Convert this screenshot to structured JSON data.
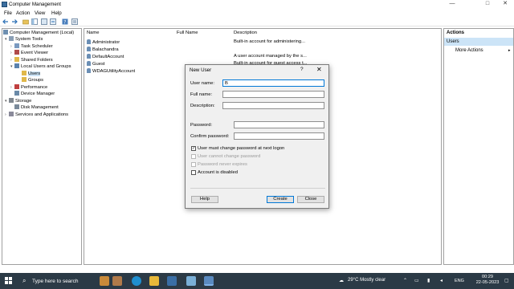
{
  "window": {
    "title": "Computer Management"
  },
  "menu": [
    "File",
    "Action",
    "View",
    "Help"
  ],
  "tree": {
    "items": [
      {
        "label": "Computer Management (Local)",
        "level": 0,
        "expander": ""
      },
      {
        "label": "System Tools",
        "level": 1,
        "expander": "▾"
      },
      {
        "label": "Task Scheduler",
        "level": 2,
        "expander": "›"
      },
      {
        "label": "Event Viewer",
        "level": 2,
        "expander": "›"
      },
      {
        "label": "Shared Folders",
        "level": 2,
        "expander": "›"
      },
      {
        "label": "Local Users and Groups",
        "level": 2,
        "expander": "▾"
      },
      {
        "label": "Users",
        "level": 3,
        "expander": ""
      },
      {
        "label": "Groups",
        "level": 3,
        "expander": ""
      },
      {
        "label": "Performance",
        "level": 2,
        "expander": "›"
      },
      {
        "label": "Device Manager",
        "level": 2,
        "expander": ""
      },
      {
        "label": "Storage",
        "level": 1,
        "expander": "▾"
      },
      {
        "label": "Disk Management",
        "level": 2,
        "expander": ""
      },
      {
        "label": "Services and Applications",
        "level": 1,
        "expander": "›"
      }
    ]
  },
  "list": {
    "columns": [
      "Name",
      "Full Name",
      "Description"
    ],
    "rows": [
      {
        "name": "Administrator",
        "full_name": "",
        "description": "Built-in account for administering..."
      },
      {
        "name": "Balachandra",
        "full_name": "",
        "description": ""
      },
      {
        "name": "DefaultAccount",
        "full_name": "",
        "description": "A user account managed by the s..."
      },
      {
        "name": "Guest",
        "full_name": "",
        "description": "Built-in account for guest access t..."
      },
      {
        "name": "WDAGUtilityAccount",
        "full_name": "",
        "description": ""
      }
    ]
  },
  "actions": {
    "header": "Actions",
    "section": "Users",
    "more": "More Actions"
  },
  "dialog": {
    "title": "New User",
    "help": "?",
    "close": "✕",
    "user_name_label": "User name:",
    "user_name_value": "B",
    "full_name_label": "Full name:",
    "full_name_value": "",
    "description_label": "Description:",
    "description_value": "",
    "password_label": "Password:",
    "confirm_label": "Confirm password:",
    "checkboxes": [
      {
        "label": "User must change password at next logon",
        "checked": true,
        "enabled": true
      },
      {
        "label": "User cannot change password",
        "checked": false,
        "enabled": false
      },
      {
        "label": "Password never expires",
        "checked": false,
        "enabled": false
      },
      {
        "label": "Account is disabled",
        "checked": false,
        "enabled": true
      }
    ],
    "help_button": "Help",
    "create_button": "Create",
    "close_button": "Close"
  },
  "taskbar": {
    "search_placeholder": "Type here to search",
    "weather": "29°C  Mostly clear",
    "lang": "ENG",
    "time": "00:29",
    "date": "22-05-2023"
  },
  "colors": {
    "accent": "#0078d7",
    "selection": "#cce4f7",
    "taskbar": "#2b3a46"
  }
}
